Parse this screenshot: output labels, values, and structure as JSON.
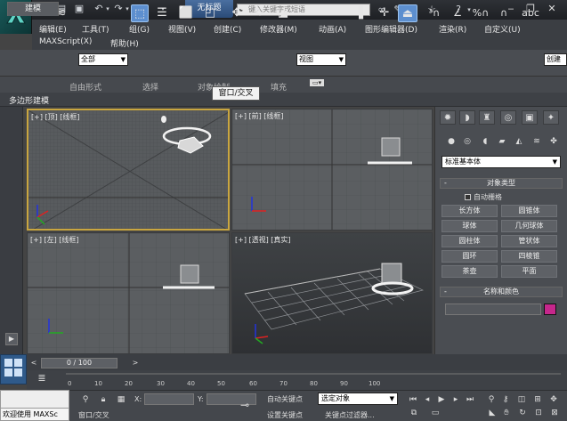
{
  "title_tab": "无标题",
  "search": {
    "placeholder": "键入关键字或短语"
  },
  "menu": [
    "编辑(E)",
    "工具(T)",
    "组(G)",
    "视图(V)",
    "创建(C)",
    "修改器(M)",
    "动画(A)",
    "图形编辑器(D)",
    "渲染(R)",
    "自定义(U)",
    "MAXScript(X)",
    "帮助(H)"
  ],
  "toolbar": {
    "selection_filter": "全部",
    "ref_coord": "视图",
    "named_sel": "创建"
  },
  "ribbon": {
    "tabs": [
      "建模",
      "自由形式",
      "选择",
      "对象绘制",
      "填充"
    ],
    "sub_label": "多边形建模",
    "tooltip": "窗口/交叉"
  },
  "viewports": {
    "top": "[+] [顶] [线框]",
    "front": "[+] [前] [线框]",
    "left": "[+] [左] [线框]",
    "persp": "[+] [透视] [真实]"
  },
  "command_panel": {
    "category": "标准基本体",
    "object_type_title": "对象类型",
    "autogrid": "自动栅格",
    "objects": [
      "长方体",
      "圆锥体",
      "球体",
      "几何球体",
      "圆柱体",
      "管状体",
      "圆环",
      "四棱锥",
      "茶壶",
      "平面"
    ],
    "name_color_title": "名称和颜色",
    "color": "#c6278c"
  },
  "timeline": {
    "frame_counter": "0 / 100",
    "ticks": [
      "0",
      "10",
      "20",
      "30",
      "40",
      "50",
      "60",
      "70",
      "80",
      "90",
      "100"
    ]
  },
  "status": {
    "maxscript": "欢迎使用 MAXSc",
    "message": "窗口/交叉",
    "x_label": "X:",
    "y_label": "Y:",
    "autokey": "自动关键点",
    "setkey": "设置关键点",
    "selection": "选定对象",
    "keyfilter": "关键点过滤器..."
  }
}
